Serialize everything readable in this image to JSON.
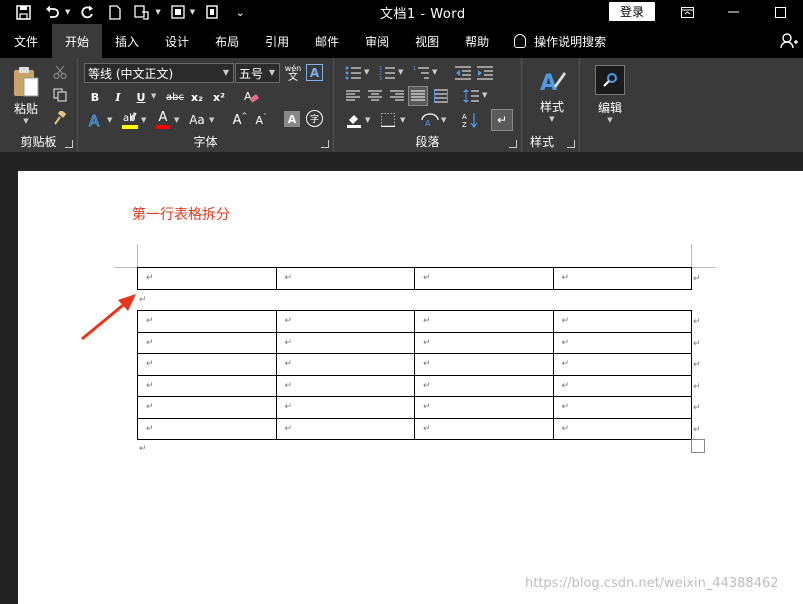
{
  "window": {
    "title": "文档1  -  Word",
    "login_label": "登录",
    "restore_glyph": "⊟",
    "min_glyph": "—",
    "max_glyph": "☐"
  },
  "qat": {
    "save_icon": "save-icon",
    "undo_icon": "undo-icon",
    "redo_icon": "redo-icon",
    "new_icon": "new-doc-icon",
    "touch_icon": "touch-mode-icon",
    "more_glyph": "⌄"
  },
  "tabs": [
    {
      "label": "文件",
      "active": false
    },
    {
      "label": "开始",
      "active": true
    },
    {
      "label": "插入",
      "active": false
    },
    {
      "label": "设计",
      "active": false
    },
    {
      "label": "布局",
      "active": false
    },
    {
      "label": "引用",
      "active": false
    },
    {
      "label": "邮件",
      "active": false
    },
    {
      "label": "审阅",
      "active": false
    },
    {
      "label": "视图",
      "active": false
    },
    {
      "label": "帮助",
      "active": false
    }
  ],
  "tell_me": "操作说明搜索",
  "ribbon": {
    "clipboard": {
      "paste_label": "粘贴",
      "group_label": "剪贴板"
    },
    "font": {
      "font_name": "等线 (中文正文)",
      "font_size": "五号",
      "group_label": "字体",
      "bold": "B",
      "italic": "I",
      "underline": "U",
      "strike": "abc",
      "subscript": "x₂",
      "superscript": "x²",
      "font_color_letter": "A",
      "case_label": "Aa",
      "grow": "A",
      "shrink": "A",
      "phonetic": "wén",
      "char_border": "A"
    },
    "paragraph": {
      "group_label": "段落"
    },
    "styles": {
      "styles_label": "样式",
      "group_label": "样式"
    },
    "editing": {
      "edit_label": "编辑"
    }
  },
  "document": {
    "heading": "第一行表格拆分",
    "para_mark": "↵",
    "table_top": {
      "rows": 1,
      "cols": 4
    },
    "table_bottom": {
      "rows": 6,
      "cols": 4
    }
  },
  "watermark": "https://blog.csdn.net/weixin_44388462",
  "colors": {
    "heading": "#e8341c",
    "arrow": "#e8341c",
    "ribbon_bg": "#3a3a3a",
    "titlebar_bg": "#000000",
    "highlight": "#ffff00",
    "font_red": "#ff0000",
    "accent_blue": "#4a9be8"
  }
}
